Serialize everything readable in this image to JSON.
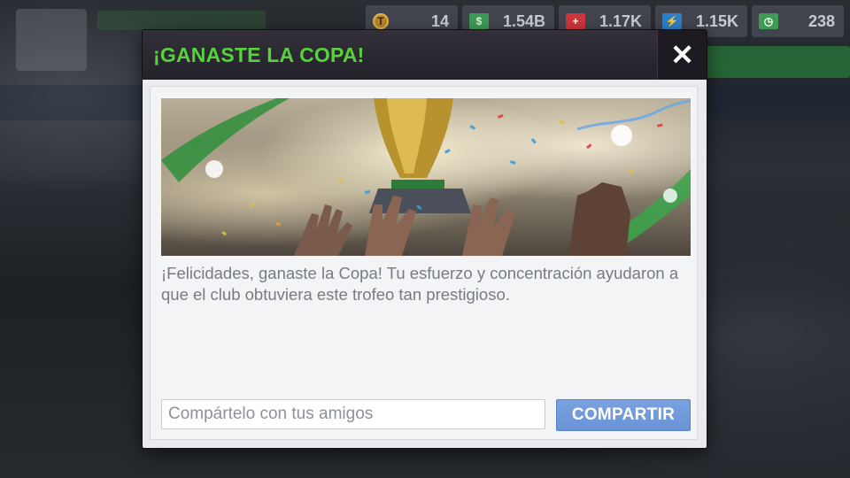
{
  "currencies": [
    {
      "icon": "token-icon",
      "value": "14",
      "symbol": "T"
    },
    {
      "icon": "cash-icon",
      "value": "1.54B",
      "symbol": "$"
    },
    {
      "icon": "medical-icon",
      "value": "1.17K",
      "symbol": "+"
    },
    {
      "icon": "energy-icon",
      "value": "1.15K",
      "symbol": "⚡"
    },
    {
      "icon": "time-icon",
      "value": "238",
      "symbol": "◷"
    }
  ],
  "modal": {
    "title": "¡GANASTE LA COPA!",
    "close_symbol": "✕",
    "message": "¡Felicidades, ganaste la Copa! Tu esfuerzo y concentración ayudaron a que el club obtuviera este trofeo tan prestigioso.",
    "share_placeholder": "Compártelo con tus amigos",
    "share_button_label": "COMPARTIR"
  },
  "colors": {
    "title_green": "#57d23c",
    "button_blue": "#6a93d6"
  }
}
